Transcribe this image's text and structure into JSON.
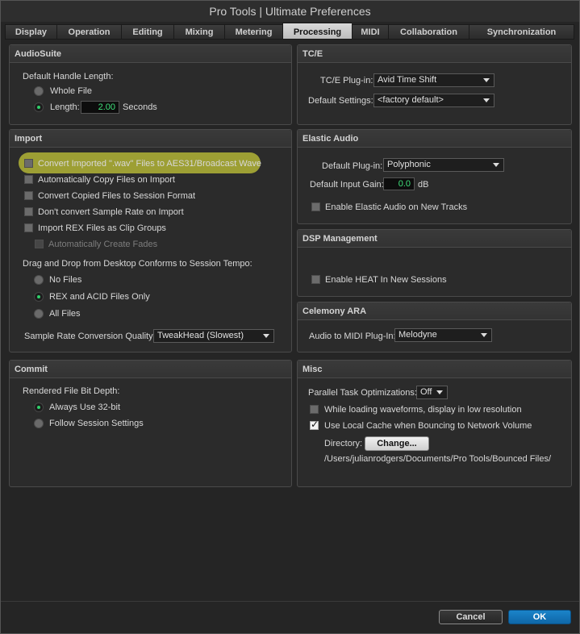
{
  "window": {
    "title": "Pro Tools | Ultimate Preferences"
  },
  "tabs": [
    {
      "label": "Display",
      "active": false
    },
    {
      "label": "Operation",
      "active": false
    },
    {
      "label": "Editing",
      "active": false
    },
    {
      "label": "Mixing",
      "active": false
    },
    {
      "label": "Metering",
      "active": false
    },
    {
      "label": "Processing",
      "active": true
    },
    {
      "label": "MIDI",
      "active": false
    },
    {
      "label": "Collaboration",
      "active": false
    },
    {
      "label": "Synchronization",
      "active": false
    }
  ],
  "audiosuite": {
    "header": "AudioSuite",
    "handle_label": "Default Handle Length:",
    "whole_file": "Whole File",
    "length": "Length:",
    "length_value": "2.00",
    "seconds": "Seconds",
    "selected": "length"
  },
  "import": {
    "header": "Import",
    "checks": [
      {
        "label": "Convert Imported \".wav\" Files to AES31/Broadcast Wave",
        "checked": false,
        "highlighted": true
      },
      {
        "label": "Automatically Copy Files on Import",
        "checked": false
      },
      {
        "label": "Convert Copied Files to Session Format",
        "checked": false
      },
      {
        "label": "Don't convert Sample Rate on Import",
        "checked": false
      },
      {
        "label": "Import REX Files as Clip Groups",
        "checked": false
      },
      {
        "label": "Automatically Create Fades",
        "checked": false,
        "disabled": true
      }
    ],
    "drag_label": "Drag and Drop from Desktop Conforms to Session Tempo:",
    "radios": [
      {
        "label": "No Files",
        "selected": false
      },
      {
        "label": "REX and ACID Files Only",
        "selected": true
      },
      {
        "label": "All Files",
        "selected": false
      }
    ],
    "src_label": "Sample Rate Conversion Quality:",
    "src_value": "TweakHead (Slowest)"
  },
  "commit": {
    "header": "Commit",
    "depth_label": "Rendered File Bit Depth:",
    "radios": [
      {
        "label": "Always Use 32-bit",
        "selected": true
      },
      {
        "label": "Follow Session Settings",
        "selected": false
      }
    ]
  },
  "tce": {
    "header": "TC/E",
    "plugin_label": "TC/E Plug-in:",
    "plugin_value": "Avid Time Shift",
    "settings_label": "Default Settings:",
    "settings_value": "<factory default>"
  },
  "elastic": {
    "header": "Elastic Audio",
    "plugin_label": "Default Plug-in:",
    "plugin_value": "Polyphonic",
    "gain_label": "Default Input Gain:",
    "gain_value": "0.0",
    "gain_unit": "dB",
    "enable_label": "Enable Elastic Audio on New Tracks",
    "enable_checked": false
  },
  "dsp": {
    "header": "DSP Management",
    "heat_label": "Enable HEAT In New Sessions",
    "heat_checked": false
  },
  "celemony": {
    "header": "Celemony ARA",
    "midi_label": "Audio to MIDI Plug-In:",
    "midi_value": "Melodyne"
  },
  "misc": {
    "header": "Misc",
    "parallel_label": "Parallel Task Optimizations:",
    "parallel_value": "Off",
    "lowres_label": "While loading waveforms, display in low resolution",
    "lowres_checked": false,
    "cache_label": "Use Local Cache when Bouncing to Network Volume",
    "cache_checked": true,
    "directory_label": "Directory:",
    "change_button": "Change...",
    "path": "/Users/julianrodgers/Documents/Pro Tools/Bounced Files/"
  },
  "footer": {
    "cancel": "Cancel",
    "ok": "OK"
  }
}
